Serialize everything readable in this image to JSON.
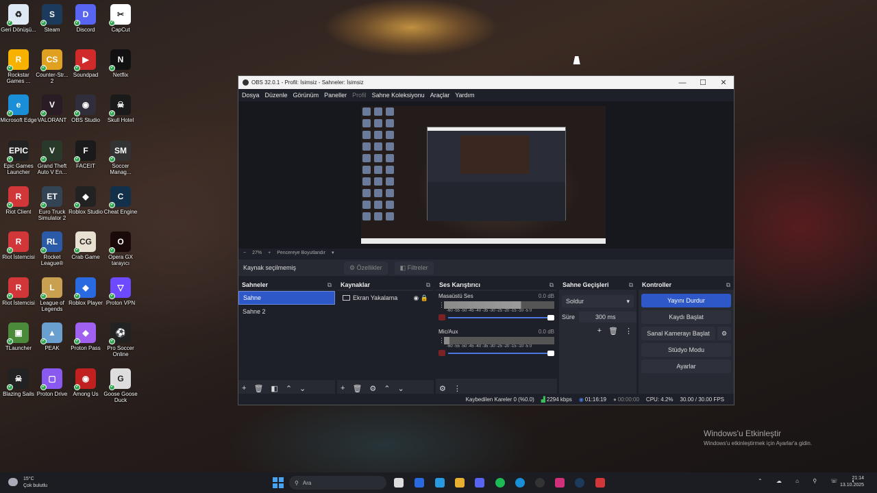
{
  "desktop": {
    "icons": [
      {
        "label": "Geri Dönüşü...",
        "icon": "recycle-bin-icon",
        "color": "#dfe8f5",
        "glyph": "♻"
      },
      {
        "label": "Steam",
        "icon": "steam-icon",
        "color": "#1b3a5c",
        "glyph": "S"
      },
      {
        "label": "Discord",
        "icon": "discord-icon",
        "color": "#5865f2",
        "glyph": "D"
      },
      {
        "label": "CapCut",
        "icon": "capcut-icon",
        "color": "#ffffff",
        "glyph": "✂"
      },
      {
        "label": "Rockstar Games ...",
        "icon": "rockstar-icon",
        "color": "#f7b200",
        "glyph": "R"
      },
      {
        "label": "Counter-Str... 2",
        "icon": "counter-strike-icon",
        "color": "#e0a020",
        "glyph": "CS"
      },
      {
        "label": "Soundpad",
        "icon": "soundpad-icon",
        "color": "#d02a2a",
        "glyph": "▶"
      },
      {
        "label": "Netflix",
        "icon": "netflix-icon",
        "color": "#111111",
        "glyph": "N"
      },
      {
        "label": "Microsoft Edge",
        "icon": "edge-icon",
        "color": "#1a8fd8",
        "glyph": "e"
      },
      {
        "label": "VALORANT",
        "icon": "valorant-icon",
        "color": "#2a1c24",
        "glyph": "V"
      },
      {
        "label": "OBS Studio",
        "icon": "obs-icon",
        "color": "#302e3a",
        "glyph": "◉"
      },
      {
        "label": "Skull Hotel",
        "icon": "skull-hotel-icon",
        "color": "#1a1a1a",
        "glyph": "☠"
      },
      {
        "label": "Epic Games Launcher",
        "icon": "epic-games-icon",
        "color": "#222222",
        "glyph": "EPIC"
      },
      {
        "label": "Grand Theft Auto V En...",
        "icon": "gta-icon",
        "color": "#2a3a2a",
        "glyph": "V"
      },
      {
        "label": "FACEIT",
        "icon": "faceit-icon",
        "color": "#1a1a1a",
        "glyph": "F"
      },
      {
        "label": "Soccer Manag...",
        "icon": "soccer-manager-icon",
        "color": "#333333",
        "glyph": "SM"
      },
      {
        "label": "Riot Client",
        "icon": "riot-client-icon",
        "color": "#d13639",
        "glyph": "R"
      },
      {
        "label": "Euro Truck Simulator 2",
        "icon": "euro-truck-icon",
        "color": "#334455",
        "glyph": "ET"
      },
      {
        "label": "Roblox Studio",
        "icon": "roblox-studio-icon",
        "color": "#222222",
        "glyph": "◆"
      },
      {
        "label": "Cheat Engine",
        "icon": "cheat-engine-icon",
        "color": "#12304a",
        "glyph": "C"
      },
      {
        "label": "Riot İstemcisi",
        "icon": "riot-client-icon",
        "color": "#d13639",
        "glyph": "R"
      },
      {
        "label": "Rocket League®",
        "icon": "rocket-league-icon",
        "color": "#2a5aa8",
        "glyph": "RL"
      },
      {
        "label": "Crab Game",
        "icon": "crab-game-icon",
        "color": "#e8e0d0",
        "glyph": "CG"
      },
      {
        "label": "Opera GX tarayıcı",
        "icon": "opera-gx-icon",
        "color": "#1a0a0a",
        "glyph": "O"
      },
      {
        "label": "Riot İstemcisi",
        "icon": "riot-client-icon",
        "color": "#d13639",
        "glyph": "R"
      },
      {
        "label": "League of Legends",
        "icon": "league-icon",
        "color": "#c8a050",
        "glyph": "L"
      },
      {
        "label": "Roblox Player",
        "icon": "roblox-player-icon",
        "color": "#2a6ae0",
        "glyph": "◆"
      },
      {
        "label": "Proton VPN",
        "icon": "proton-vpn-icon",
        "color": "#6d4aff",
        "glyph": "▽"
      },
      {
        "label": "TLauncher",
        "icon": "tlauncher-icon",
        "color": "#4a8a3a",
        "glyph": "▣"
      },
      {
        "label": "PEAK",
        "icon": "peak-icon",
        "color": "#6aa0d0",
        "glyph": "▲"
      },
      {
        "label": "Proton Pass",
        "icon": "proton-pass-icon",
        "color": "#a060f0",
        "glyph": "◆"
      },
      {
        "label": "Pro Soccer Online",
        "icon": "pro-soccer-icon",
        "color": "#222222",
        "glyph": "⚽"
      },
      {
        "label": "Blazing Sails",
        "icon": "blazing-sails-icon",
        "color": "#222222",
        "glyph": "☠"
      },
      {
        "label": "Proton Drive",
        "icon": "proton-drive-icon",
        "color": "#8a5af0",
        "glyph": "▢"
      },
      {
        "label": "Among Us",
        "icon": "among-us-icon",
        "color": "#c02020",
        "glyph": "◉"
      },
      {
        "label": "Goose Goose Duck",
        "icon": "goose-goose-duck-icon",
        "color": "#dddddd",
        "glyph": "G"
      }
    ]
  },
  "obs": {
    "title": "OBS 32.0.1 - Profil: İsimsiz - Sahneler: İsimsiz",
    "window_controls": {
      "minimize": "—",
      "maximize": "☐",
      "close": "✕"
    },
    "menu": [
      "Dosya",
      "Düzenle",
      "Görünüm",
      "Paneller",
      "Profil",
      "Sahne Koleksiyonu",
      "Araçlar",
      "Yardım"
    ],
    "zoom": {
      "minus": "−",
      "value": "27%",
      "plus": "+",
      "mode": "Pencereye Boyutlandır",
      "chevron": "▾"
    },
    "source_bar": {
      "status": "Kaynak seçilmemiş",
      "properties": "Özellikler",
      "filters": "Filtreler"
    },
    "scenes": {
      "title": "Sahneler",
      "items": [
        "Sahne",
        "Sahne 2"
      ],
      "selected": 0
    },
    "sources": {
      "title": "Kaynaklar",
      "items": [
        "Ekran Yakalama"
      ]
    },
    "mixer": {
      "title": "Ses Karıştırıcı",
      "channels": [
        {
          "name": "Masaüstü Ses",
          "db": "0.0 dB",
          "scale": "-60 -55 -50 -45 -40 -35 -30 -25 -20 -15 -10 -5 0",
          "level": 0.7
        },
        {
          "name": "Mic/Aux",
          "db": "0.0 dB",
          "scale": "-60 -55 -50 -45 -40 -35 -30 -25 -20 -15 -10 -5 0",
          "level": 0.05
        }
      ]
    },
    "transitions": {
      "title": "Sahne Geçişleri",
      "selected": "Soldur",
      "duration_label": "Süre",
      "duration": "300 ms"
    },
    "controls": {
      "title": "Kontroller",
      "stop_stream": "Yayını Durdur",
      "start_record": "Kaydı Başlat",
      "virtual_cam": "Sanal Kamerayı Başlat",
      "studio_mode": "Stüdyo Modu",
      "settings": "Ayarlar"
    },
    "status": {
      "dropped": "Kaybedilen Kareler 0 (%0.0)",
      "bitrate": "2294 kbps",
      "stream_time": "01:16:19",
      "record_time": "00:00:00",
      "cpu": "CPU: 4.2%",
      "fps": "30.00 / 30.00 FPS"
    }
  },
  "activation": {
    "title": "Windows'u Etkinleştir",
    "subtitle": "Windows'u etkinleştirmek için Ayarlar'a gidin."
  },
  "taskbar": {
    "weather_temp": "15°C",
    "weather_desc": "Çok bulutlu",
    "search_placeholder": "Ara",
    "time": "21:14",
    "date": "13.10.2025",
    "tray_icons": "⌃ ☁ ⌂ ⚲ ☏ ◖"
  }
}
